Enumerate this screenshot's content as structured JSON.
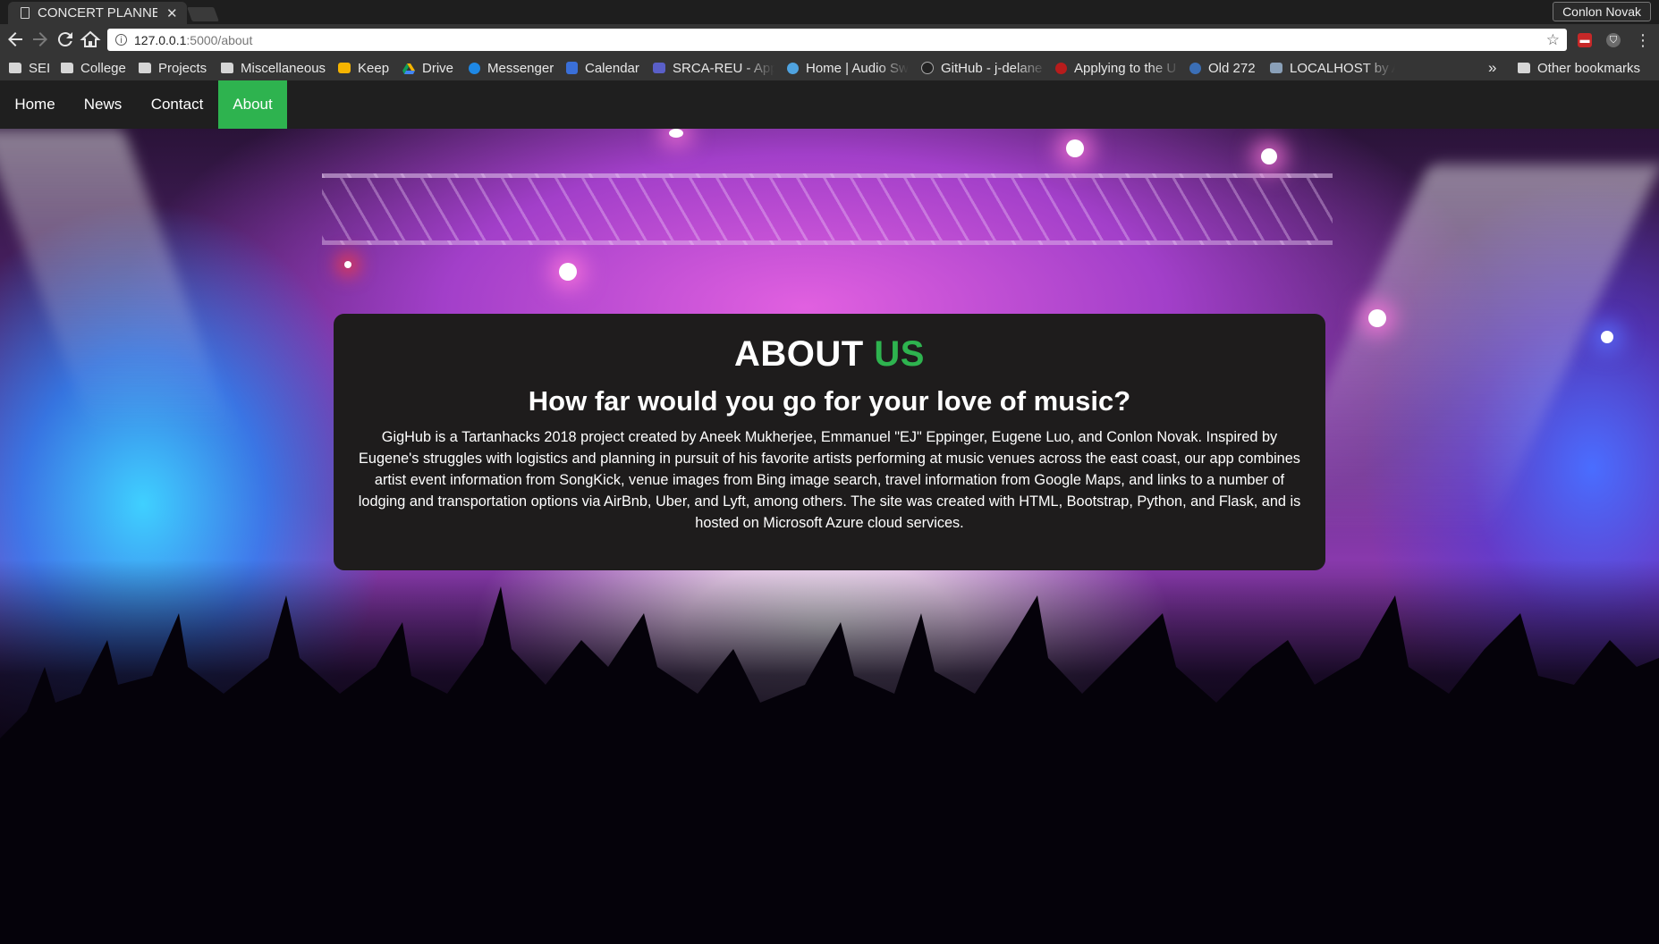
{
  "browser": {
    "tab_title": "CONCERT PLANNER",
    "tab_close": "✕",
    "profile_name": "Conlon Novak",
    "url_host": "127.0.0.1",
    "url_path": ":5000/about",
    "nav_icons": {
      "back": "back-arrow-icon",
      "forward": "forward-arrow-icon",
      "reload": "reload-icon",
      "home": "home-icon"
    },
    "bookmarks": [
      {
        "label": "SEI",
        "icon": "folder-icon"
      },
      {
        "label": "College",
        "icon": "folder-icon"
      },
      {
        "label": "Projects",
        "icon": "folder-icon"
      },
      {
        "label": "Miscellaneous",
        "icon": "folder-icon"
      },
      {
        "label": "Keep",
        "icon": "keep-icon"
      },
      {
        "label": "Drive",
        "icon": "drive-icon"
      },
      {
        "label": "Messenger",
        "icon": "messenger-icon"
      },
      {
        "label": "Calendar",
        "icon": "calendar-icon"
      },
      {
        "label": "SRCA-REU - Appl",
        "icon": "form-icon"
      },
      {
        "label": "Home | Audio Sw",
        "icon": "audio-icon"
      },
      {
        "label": "GitHub - j-delane",
        "icon": "github-icon"
      },
      {
        "label": "Applying to the U",
        "icon": "red-icon"
      },
      {
        "label": "Old 272",
        "icon": "globe-icon"
      },
      {
        "label": "LOCALHOST by A",
        "icon": "image-icon"
      }
    ],
    "overflow": "»",
    "other_bookmarks": "Other bookmarks"
  },
  "nav": {
    "items": [
      "Home",
      "News",
      "Contact",
      "About"
    ],
    "active": "About"
  },
  "about": {
    "title_main": "ABOUT",
    "title_accent": "US",
    "subtitle": "How far would you go for your love of music?",
    "body": "GigHub is a Tartanhacks 2018 project created by Aneek Mukherjee, Emmanuel \"EJ\" Eppinger, Eugene Luo, and Conlon Novak. Inspired by Eugene's struggles with logistics and planning in pursuit of his favorite artists performing at music venues across the east coast, our app combines artist event information from SongKick, venue images from Bing image search, travel information from Google Maps, and links to a number of lodging and transportation options via AirBnb, Uber, and Lyft, among others. The site was created with HTML, Bootstrap, Python, and Flask, and is hosted on Microsoft Azure cloud services."
  },
  "colors": {
    "accent": "#2eb34f",
    "card_bg": "#1e1c1c",
    "navbar_bg": "#1f1f1f"
  }
}
